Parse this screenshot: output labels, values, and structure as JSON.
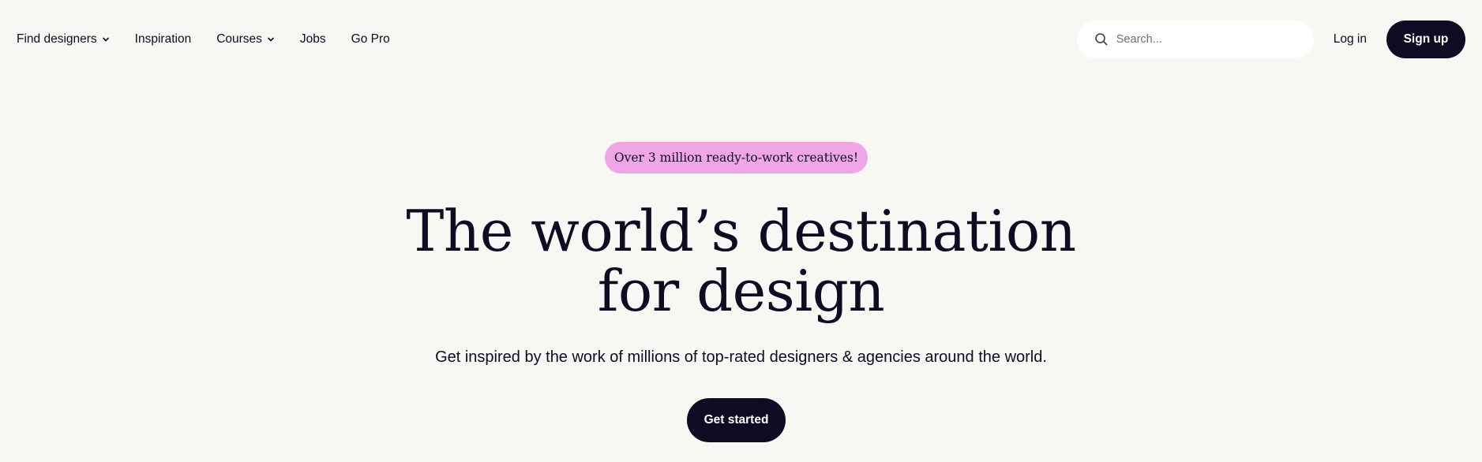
{
  "nav": {
    "items": [
      {
        "label": "Find designers",
        "has_dropdown": true
      },
      {
        "label": "Inspiration",
        "has_dropdown": false
      },
      {
        "label": "Courses",
        "has_dropdown": true
      },
      {
        "label": "Jobs",
        "has_dropdown": false
      },
      {
        "label": "Go Pro",
        "has_dropdown": false
      }
    ],
    "search": {
      "placeholder": "Search...",
      "value": "",
      "icon": "search-icon"
    },
    "login_label": "Log in",
    "signup_label": "Sign up"
  },
  "hero": {
    "badge": "Over 3 million ready-to-work creatives!",
    "headline_line1": "The world’s destination",
    "headline_line2": "for design",
    "subheadline": "Get inspired by the work of millions of top-rated designers & agencies around the world.",
    "cta_label": "Get started"
  },
  "colors": {
    "background": "#f8f7f4",
    "primary_dark": "#0d0c22",
    "badge_pink": "#f0a6e6",
    "search_bg": "#ffffff"
  }
}
